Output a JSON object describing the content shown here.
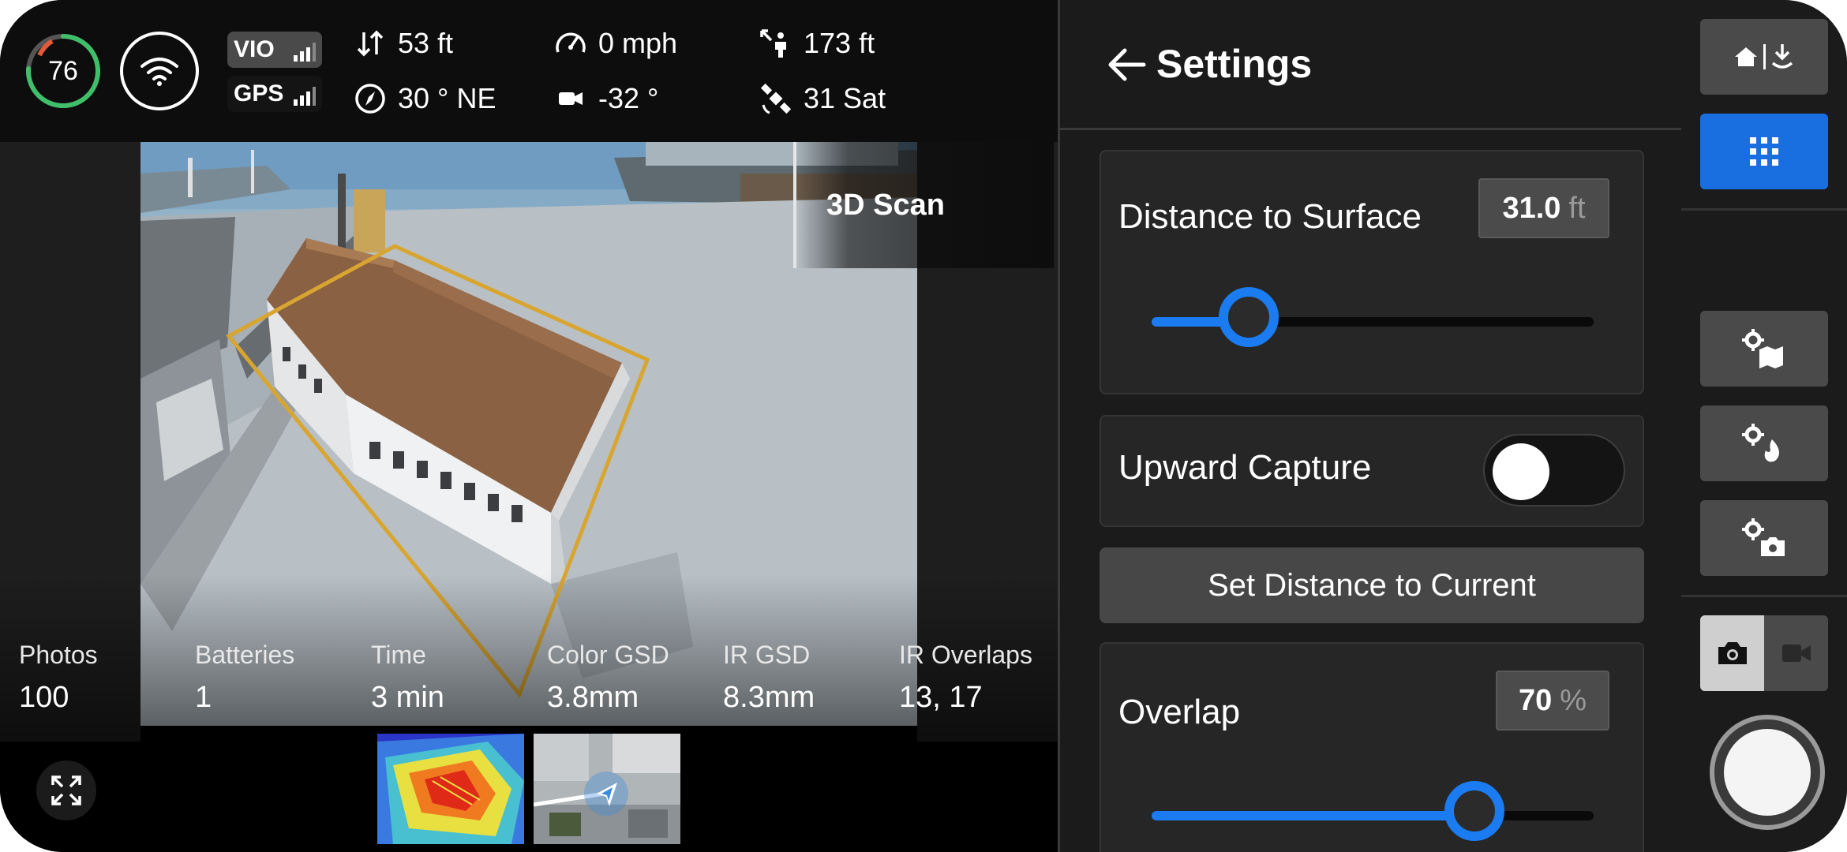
{
  "hud": {
    "battery_percent": "76",
    "nav_vio": "VIO",
    "nav_gps": "GPS",
    "telemetry": {
      "vertical_altitude": "53 ft",
      "speed": "0 mph",
      "distance_from_home": "173 ft",
      "heading": "30 ° NE",
      "gimbal_pitch": "-32 °",
      "satellites": "31 Sat"
    }
  },
  "mode_label": "3D Scan",
  "stats": [
    {
      "label": "Photos",
      "value": "100"
    },
    {
      "label": "Batteries",
      "value": "1"
    },
    {
      "label": "Time",
      "value": "3 min"
    },
    {
      "label": "Color GSD",
      "value": "3.8mm"
    },
    {
      "label": "IR GSD",
      "value": "8.3mm"
    },
    {
      "label": "IR Overlaps",
      "value": "13, 17"
    }
  ],
  "settings": {
    "title": "Settings",
    "distance_to_surface": {
      "label": "Distance to Surface",
      "value": "31.0",
      "unit": "ft",
      "slider_fraction": 0.22
    },
    "upward_capture": {
      "label": "Upward Capture",
      "enabled": false
    },
    "set_distance_button": "Set Distance to Current",
    "overlap": {
      "label": "Overlap",
      "value": "70",
      "unit": "%",
      "slider_fraction": 0.73
    }
  },
  "rail": {
    "active_button": "grid-menu",
    "capture_mode": "photo"
  },
  "colors": {
    "accent_blue": "#1a7cf0",
    "battery_green": "#3fbf6a",
    "scan_outline": "#d9a531",
    "panel_bg": "#1b1b1b"
  }
}
